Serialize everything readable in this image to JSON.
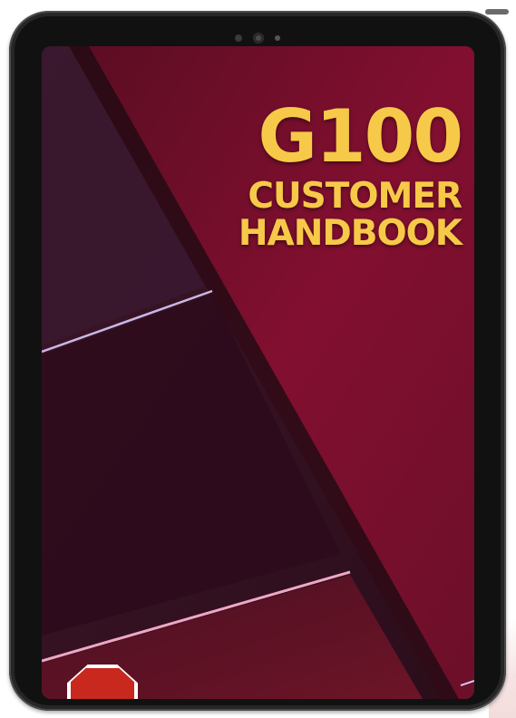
{
  "cover": {
    "title_line1": "G100",
    "title_line2": "CUSTOMER",
    "title_line3": "HANDBOOK"
  },
  "colors": {
    "title": "#f7c948",
    "bezel": "#262626",
    "screen_dark": "#3a1324",
    "screen_crimson": "#7c1230",
    "accent_line": "#e8c7e0",
    "badge": "#c8281e"
  },
  "icons": {
    "camera": "camera-icon",
    "badge": "octagon-badge-icon"
  }
}
